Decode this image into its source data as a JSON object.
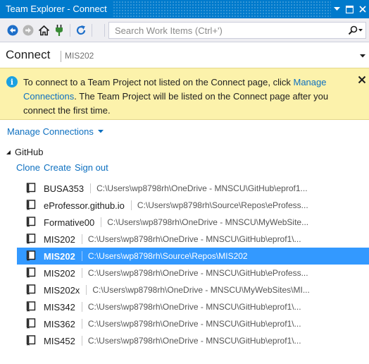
{
  "window": {
    "title": "Team Explorer - Connect"
  },
  "toolbar": {
    "buttons": [
      "back-icon",
      "forward-icon",
      "home-icon",
      "connect-plug-icon",
      "refresh-icon"
    ],
    "search_placeholder": "Search Work Items (Ctrl+')"
  },
  "page": {
    "title": "Connect",
    "subtitle": "MIS202"
  },
  "infobar": {
    "text_before": "To connect to a Team Project not listed on the Connect page, click",
    "link": "Manage Connections",
    "text_after": ".  The Team Project will be listed on the Connect page after you connect the first time."
  },
  "manage_connections": {
    "label": "Manage Connections"
  },
  "github": {
    "title": "GitHub",
    "actions": [
      "Clone",
      "Create",
      "Sign out"
    ]
  },
  "repos": [
    {
      "name": "BUSA353",
      "path": "C:\\Users\\wp8798rh\\OneDrive - MNSCU\\GitHub\\eprof1...",
      "selected": false
    },
    {
      "name": "eProfessor.github.io",
      "path": "C:\\Users\\wp8798rh\\Source\\Repos\\eProfess...",
      "selected": false
    },
    {
      "name": "Formative00",
      "path": "C:\\Users\\wp8798rh\\OneDrive - MNSCU\\MyWebSite...",
      "selected": false
    },
    {
      "name": "MIS202",
      "path": "C:\\Users\\wp8798rh\\OneDrive - MNSCU\\GitHub\\eprof1\\...",
      "selected": false
    },
    {
      "name": "MIS202",
      "path": "C:\\Users\\wp8798rh\\Source\\Repos\\MIS202",
      "selected": true
    },
    {
      "name": "MIS202",
      "path": "C:\\Users\\wp8798rh\\OneDrive - MNSCU\\GitHub\\eProfess...",
      "selected": false
    },
    {
      "name": "MIS202x",
      "path": "C:\\Users\\wp8798rh\\OneDrive - MNSCU\\MyWebSites\\MI...",
      "selected": false
    },
    {
      "name": "MIS342",
      "path": "C:\\Users\\wp8798rh\\OneDrive - MNSCU\\GitHub\\eprof1\\...",
      "selected": false
    },
    {
      "name": "MIS362",
      "path": "C:\\Users\\wp8798rh\\OneDrive - MNSCU\\GitHub\\eprof1\\...",
      "selected": false
    },
    {
      "name": "MIS452",
      "path": "C:\\Users\\wp8798rh\\OneDrive - MNSCU\\GitHub\\eprof1\\...",
      "selected": false
    }
  ],
  "colors": {
    "titlebar": "#007acc",
    "toolbar": "#eeeef2",
    "infobar": "#fcf2ab",
    "link": "#0e70c0",
    "selection": "#3399ff"
  }
}
